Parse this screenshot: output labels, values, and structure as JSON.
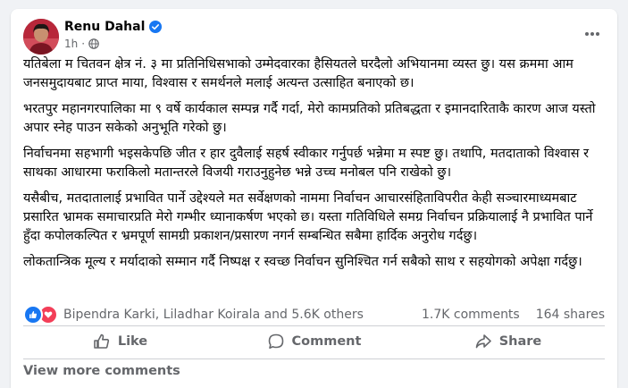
{
  "post": {
    "author": "Renu Dahal",
    "timestamp": "1h",
    "paragraphs": [
      "यतिबेला म चितवन क्षेत्र नं. ३ मा प्रतिनिधिसभाको उम्मेदवारका हैसियतले घरदैलो अभियानमा व्यस्त छु। यस क्रममा आम जनसमुदायबाट प्राप्त माया, विश्वास र समर्थनले मलाई अत्यन्त उत्साहित बनाएको छ।",
      "भरतपुर महानगरपालिका मा ९ वर्षे कार्यकाल सम्पन्न गर्दै गर्दा, मेरो कामप्रतिको प्रतिबद्धता र इमानदारिताकै कारण आज यस्तो अपार स्नेह पाउन सकेको अनुभूति गरेको छु।",
      "निर्वाचनमा सहभागी भइसकेपछि जीत र हार दुवैलाई सहर्ष स्वीकार गर्नुपर्छ भन्नेमा म स्पष्ट छु। तथापि, मतदाताको विश्वास र साथका आधारमा फराकिलो मतान्तरले विजयी गराउनुहुनेछ भन्ने उच्च मनोबल पनि राखेको छु।",
      "यसैबीच, मतदातालाई प्रभावित पार्ने उद्देश्यले मत सर्वेक्षणको नाममा निर्वाचन आचारसंहिताविपरीत केही सञ्चारमाध्यमबाट प्रसारित भ्रामक समाचारप्रति मेरो गम्भीर ध्यानाकर्षण भएको छ। यस्ता गतिविधिले समग्र निर्वाचन प्रक्रियालाई नै प्रभावित पार्ने हुँदा कपोलकल्पित र भ्रमपूर्ण सामग्री प्रकाशन/प्रसारण नगर्न सम्बन्धित सबैमा हार्दिक अनुरोध गर्दछु।",
      "लोकतान्त्रिक मूल्य र मर्यादाको सम्मान गर्दै निष्पक्ष र स्वच्छ निर्वाचन सुनिश्चित गर्न सबैको साथ र सहयोगको अपेक्षा गर्दछु।"
    ]
  },
  "stats": {
    "reactors": "Bipendra Karki, Liladhar Koirala and 5.6K others",
    "comments": "1.7K comments",
    "shares": "164 shares"
  },
  "actions": {
    "like": "Like",
    "comment": "Comment",
    "share": "Share"
  },
  "footer": {
    "view_more": "View more comments"
  },
  "colors": {
    "accent": "#1877f2",
    "love": "#f33e58",
    "muted_text": "#65676b"
  },
  "icons": [
    "verified-badge-icon",
    "globe-icon",
    "more-options-icon",
    "like-reaction-icon",
    "love-reaction-icon",
    "like-icon",
    "comment-icon",
    "share-icon"
  ]
}
